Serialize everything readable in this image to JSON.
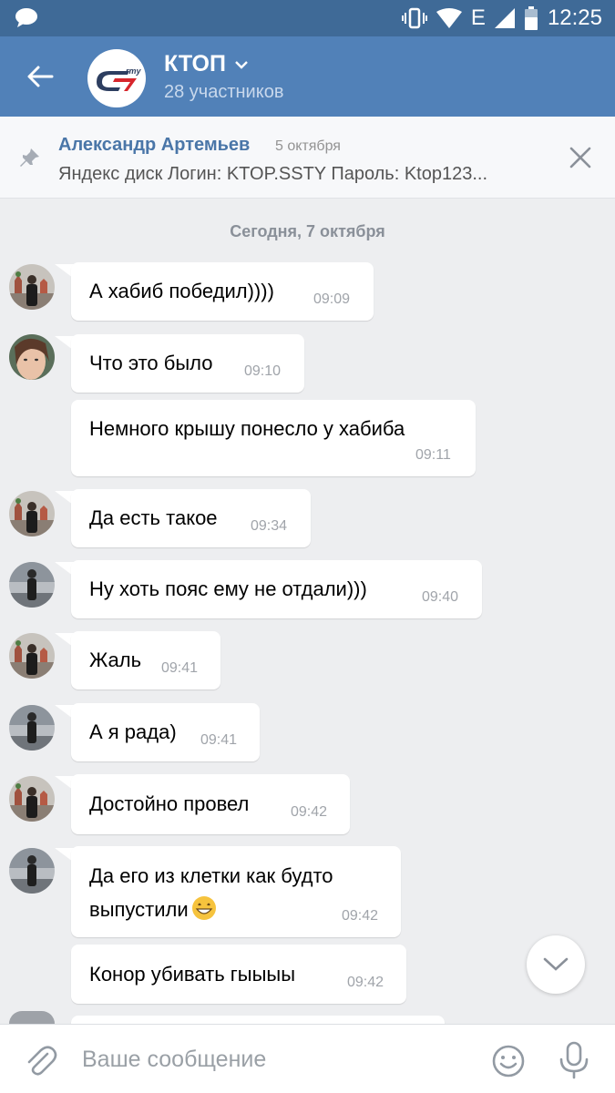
{
  "status_bar": {
    "network": "E",
    "time": "12:25",
    "icons": [
      "chat-icon",
      "vibrate-icon",
      "wifi-icon",
      "signal-icon",
      "battery-icon"
    ]
  },
  "header": {
    "title": "КТОП",
    "subtitle": "28 участников",
    "logo_text": "rmy"
  },
  "pinned": {
    "author": "Александр Артемьев",
    "date": "5 октября",
    "text": "Яндекс диск Логин: KTOP.SSTY Пароль: Ktop123..."
  },
  "date_separator": "Сегодня, 7 октября",
  "messages": [
    {
      "text": "А хабиб победил))))",
      "time": "09:09"
    },
    {
      "text": "Что это было",
      "time": "09:10"
    },
    {
      "text": "Немного крышу понесло у хабиба",
      "time": "09:11"
    },
    {
      "text": "Да есть такое",
      "time": "09:34"
    },
    {
      "text": "Ну хоть пояс ему не отдали)))",
      "time": "09:40"
    },
    {
      "text": "Жаль",
      "time": "09:41"
    },
    {
      "text": "А я рада)",
      "time": "09:41"
    },
    {
      "text": "Достойно провел",
      "time": "09:42"
    },
    {
      "text_line1": "Да его из клетки как будто",
      "text_line2": "выпустили",
      "time": "09:42"
    },
    {
      "text": "Конор убивать гыыыы",
      "time": "09:42"
    }
  ],
  "composer": {
    "placeholder": "Ваше сообщение"
  },
  "colors": {
    "header": "#5181b8",
    "status_bar": "#3f6a97",
    "background": "#edeef0",
    "link": "#4a76a8"
  }
}
